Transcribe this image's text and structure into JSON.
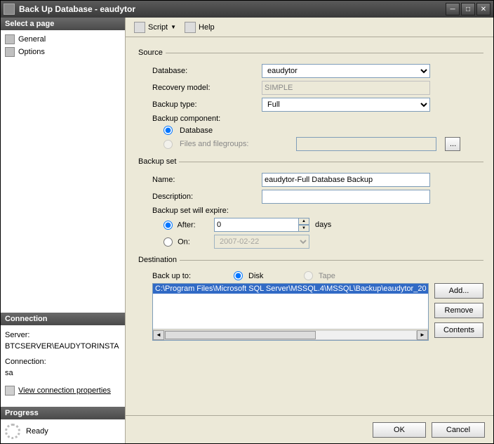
{
  "window": {
    "title": "Back Up Database - eaudytor"
  },
  "left": {
    "pages_header": "Select a page",
    "general": "General",
    "options": "Options",
    "connection_header": "Connection",
    "server_label": "Server:",
    "server_value": "BTCSERVER\\EAUDYTORINSTA",
    "conn_label": "Connection:",
    "conn_value": "sa",
    "view_conn_props": "View connection properties",
    "progress_header": "Progress",
    "progress_value": "Ready"
  },
  "toolbar": {
    "script": "Script",
    "help": "Help"
  },
  "source": {
    "legend": "Source",
    "database_label": "Database:",
    "database_value": "eaudytor",
    "recovery_label": "Recovery model:",
    "recovery_value": "SIMPLE",
    "backup_type_label": "Backup type:",
    "backup_type_value": "Full",
    "component_label": "Backup component:",
    "opt_database": "Database",
    "opt_files": "Files and filegroups:"
  },
  "backupset": {
    "legend": "Backup set",
    "name_label": "Name:",
    "name_value": "eaudytor-Full Database Backup",
    "desc_label": "Description:",
    "desc_value": "",
    "expire_label": "Backup set will expire:",
    "after_label": "After:",
    "after_value": "0",
    "days_label": "days",
    "on_label": "On:",
    "on_value": "2007-02-22"
  },
  "destination": {
    "legend": "Destination",
    "backupto_label": "Back up to:",
    "disk_label": "Disk",
    "tape_label": "Tape",
    "path": "C:\\Program Files\\Microsoft SQL Server\\MSSQL.4\\MSSQL\\Backup\\eaudytor_20",
    "add_btn": "Add...",
    "remove_btn": "Remove",
    "contents_btn": "Contents"
  },
  "footer": {
    "ok": "OK",
    "cancel": "Cancel"
  }
}
